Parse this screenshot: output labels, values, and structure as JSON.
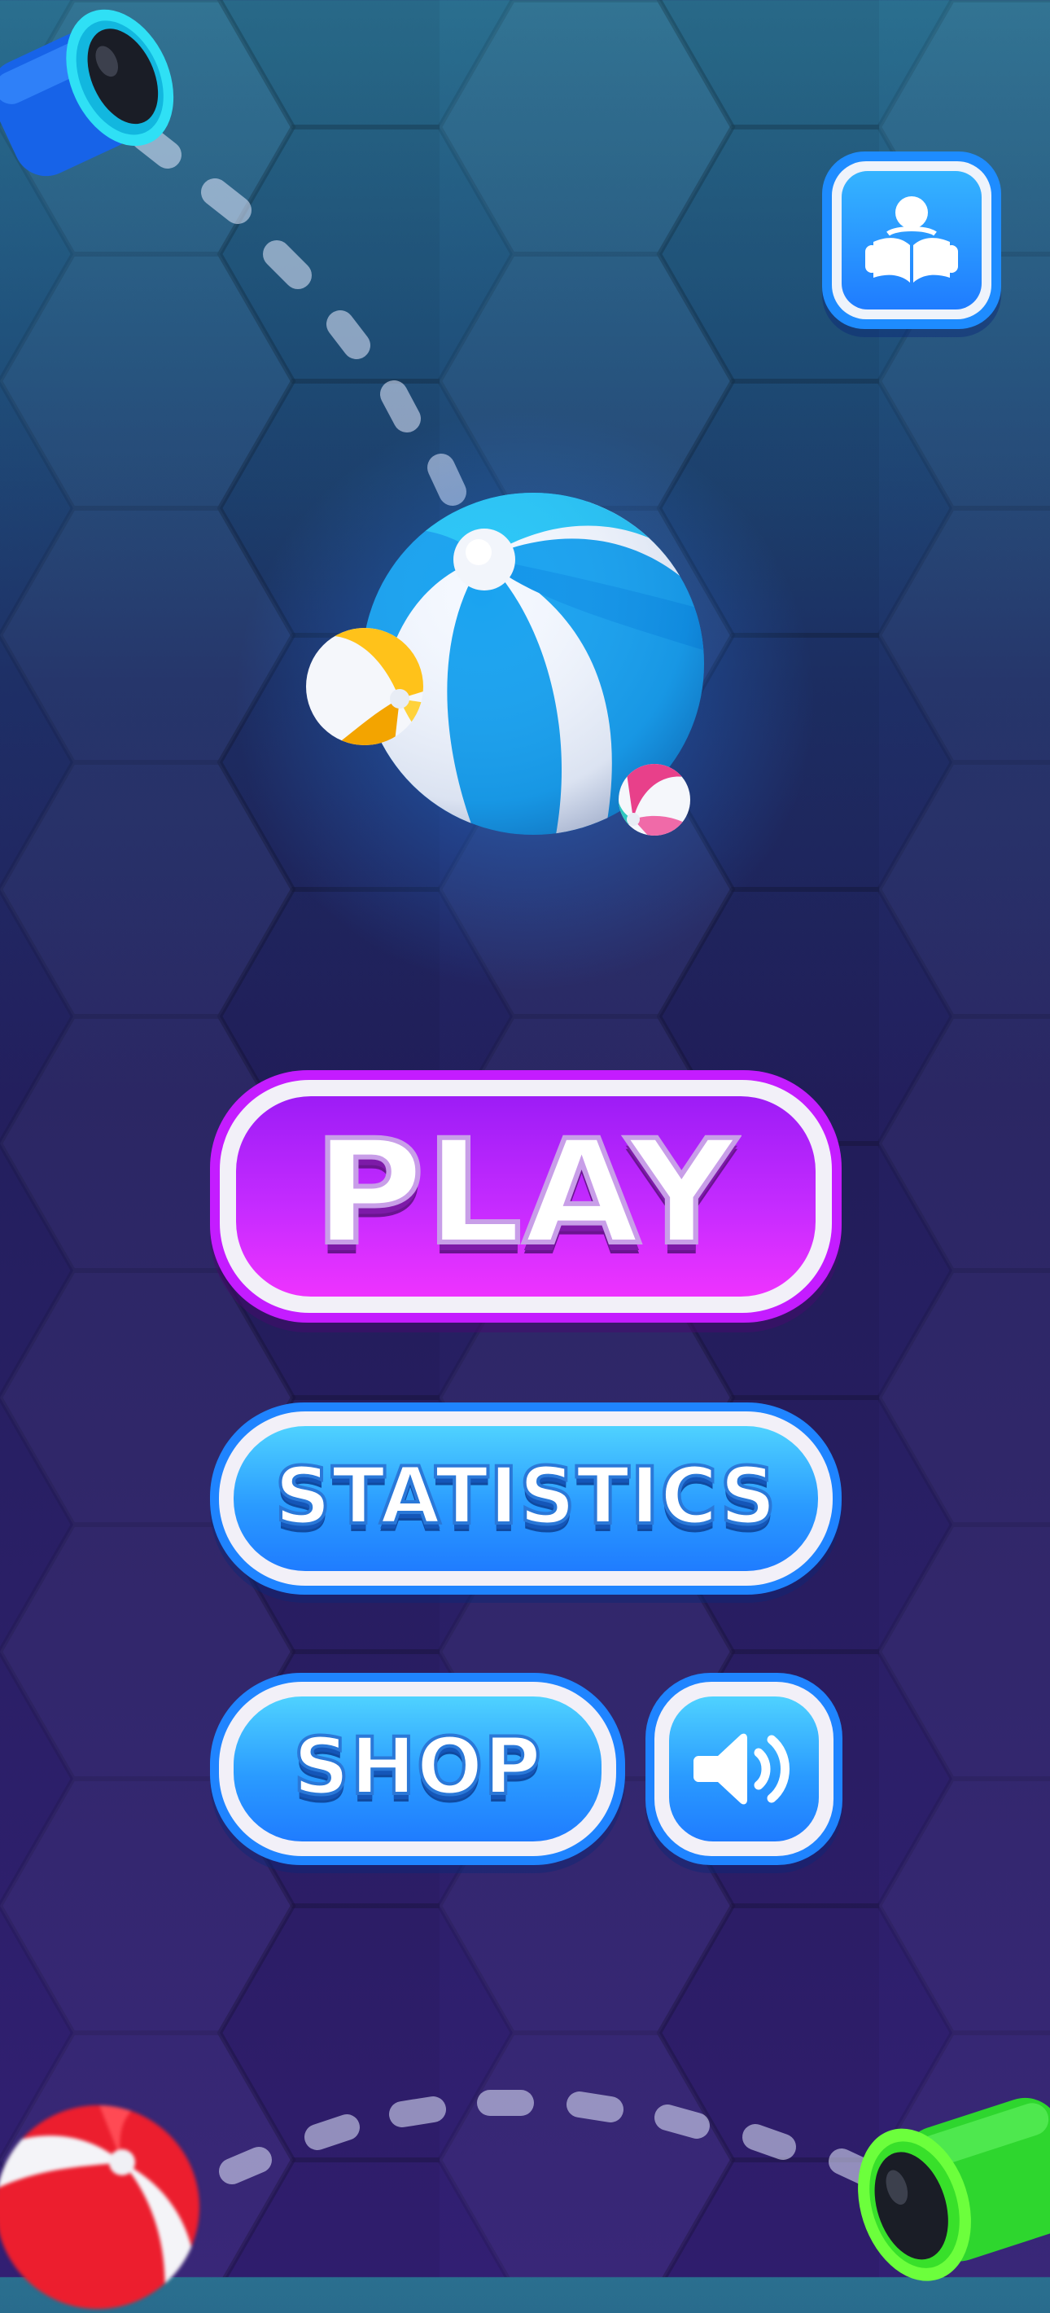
{
  "menu": {
    "play_label": "PLAY",
    "statistics_label": "STATISTICS",
    "shop_label": "SHOP"
  },
  "icons": {
    "guide": "reading-person-icon",
    "sound": "speaker-volume-icon"
  },
  "colors": {
    "play_accent": "#c41cff",
    "blue_accent": "#1f84ff",
    "background_top": "#2a6f8f",
    "background_bottom": "#321f73"
  }
}
